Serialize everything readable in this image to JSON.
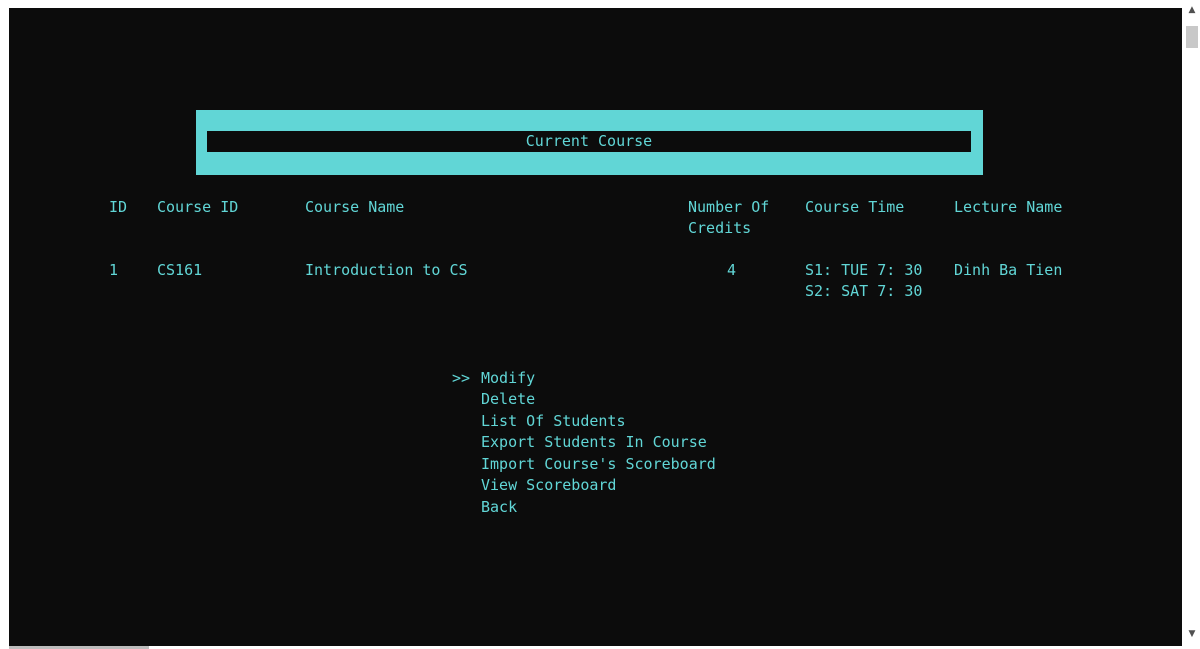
{
  "banner": {
    "title": "Current Course"
  },
  "table": {
    "headers": {
      "id": "ID",
      "course_id": "Course ID",
      "course_name": "Course Name",
      "credits_line1": "Number Of",
      "credits_line2": "Credits",
      "course_time": "Course Time",
      "lecture_name": "Lecture Name"
    },
    "rows": [
      {
        "id": "1",
        "course_id": "CS161",
        "course_name": "Introduction to CS",
        "credits": "4",
        "time_s1": "S1: TUE 7: 30",
        "time_s2": "S2: SAT 7: 30",
        "lecturer": "Dinh Ba Tien"
      }
    ]
  },
  "menu": {
    "cursor": ">>",
    "items": [
      "Modify",
      "Delete",
      "List Of Students",
      "Export Students In Course",
      "Import Course's Scoreboard",
      "View Scoreboard",
      "Back"
    ],
    "selected_index": 0
  },
  "scrollbar": {
    "up_icon": "chevron-up-icon",
    "down_icon": "chevron-down-icon"
  },
  "colors": {
    "background": "#0c0c0c",
    "text": "#61d6d6",
    "banner": "#61d6d6"
  }
}
